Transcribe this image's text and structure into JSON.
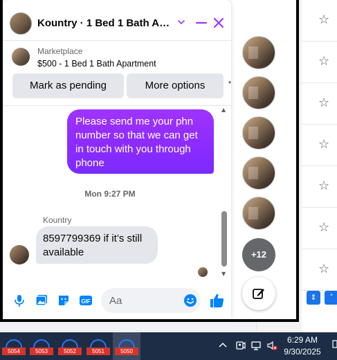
{
  "chat": {
    "title": "Kountry · 1 Bed 1 Bath Apa...",
    "marketplace_label": "Marketplace",
    "listing_title": "$500 - 1 Bed 1 Bath Apartment",
    "mark_pending_label": "Mark as pending",
    "more_options_label": "More options",
    "outgoing_message": "Please send me your phn number so that we can get in touch with you through phone",
    "timestamp": "Mon 9:27 PM",
    "sender_name": "Kountry",
    "incoming_message": "8597799369 if it’s still available",
    "composer_placeholder": "Aa"
  },
  "chat_heads": {
    "more_count": "+12"
  },
  "taskbar": {
    "apps": [
      "5054",
      "5053",
      "5052",
      "5051",
      "5050"
    ],
    "time": "6:29 AM",
    "date": "9/30/2025"
  },
  "colors": {
    "accent": "#a033ff",
    "icon_blue": "#0084ff"
  }
}
